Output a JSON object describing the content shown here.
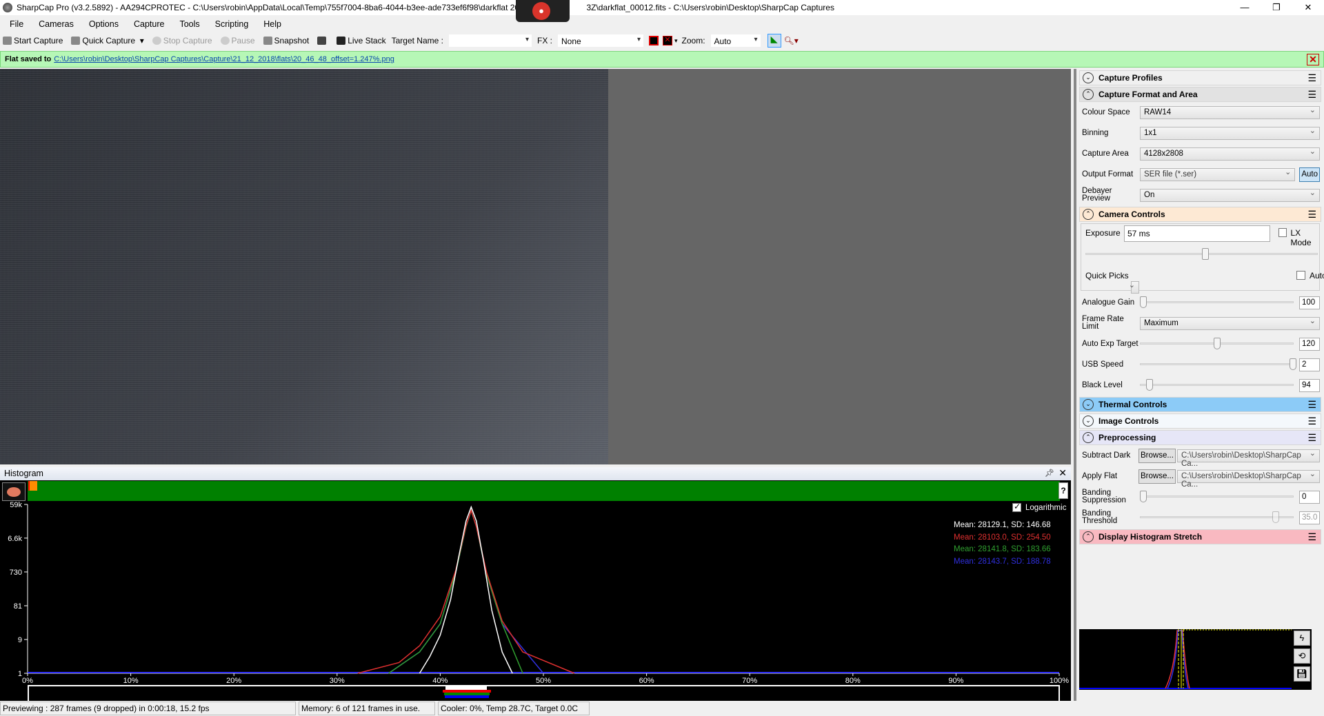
{
  "window": {
    "title": "SharpCap Pro (v3.2.5892) - AA294CPROTEC - C:\\Users\\robin\\AppData\\Local\\Temp\\755f7004-8ba6-4044-b3ee-ade733ef6f98\\darkflat 2018-",
    "title_tail": "3Z\\darkflat_00012.fits - C:\\Users\\robin\\Desktop\\SharpCap Captures",
    "minimize": "—",
    "restore": "❐",
    "close": "✕"
  },
  "menu": [
    "File",
    "Cameras",
    "Options",
    "Capture",
    "Tools",
    "Scripting",
    "Help"
  ],
  "toolbar": {
    "start_capture": "Start Capture",
    "quick_capture": "Quick Capture",
    "stop_capture": "Stop Capture",
    "pause": "Pause",
    "snapshot": "Snapshot",
    "live_stack": "Live Stack",
    "target_name_label": "Target Name :",
    "target_name_value": "",
    "fx_label": "FX :",
    "fx_value": "None",
    "zoom_label": "Zoom:",
    "zoom_value": "Auto"
  },
  "notice": {
    "prefix": "Flat saved to",
    "link": "C:\\Users\\robin\\Desktop\\SharpCap Captures\\Capture\\21_12_2018\\flats\\20_46_48_offset=1.247%.png",
    "close": "✕"
  },
  "histogram": {
    "title": "Histogram",
    "help": "?",
    "log_label": "Logarithmic",
    "log_checked": true,
    "stats": [
      {
        "text": "Mean: 28129.1, SD: 146.68",
        "color": "#ffffff"
      },
      {
        "text": "Mean: 28103.0, SD: 254.50",
        "color": "#e03030"
      },
      {
        "text": "Mean: 28141.8, SD: 183.66",
        "color": "#30a030"
      },
      {
        "text": "Mean: 28143.7, SD: 188.78",
        "color": "#3030e0"
      }
    ]
  },
  "chart_data": {
    "type": "line",
    "yscale": "log",
    "ylim": [
      1,
      59000
    ],
    "xlim": [
      0,
      100
    ],
    "y_ticks": [
      "59k",
      "6.6k",
      "730",
      "81",
      "9",
      "1"
    ],
    "y_tick_values": [
      59000,
      6600,
      730,
      81,
      9,
      1
    ],
    "x_ticks": [
      "0%",
      "10%",
      "20%",
      "30%",
      "40%",
      "50%",
      "60%",
      "70%",
      "80%",
      "90%",
      "100%"
    ],
    "series": [
      {
        "color": "#ffffff",
        "x": [
          38,
          39,
          40,
          41,
          41.8,
          42.5,
          43,
          43.5,
          44.2,
          45,
          46,
          47
        ],
        "y": [
          1,
          3,
          12,
          120,
          2000,
          20000,
          50000,
          20000,
          1500,
          60,
          4,
          1
        ]
      },
      {
        "color": "#e03030",
        "x": [
          32,
          36,
          38,
          40,
          41.5,
          42.5,
          43,
          43.5,
          44.5,
          46,
          48,
          53
        ],
        "y": [
          1,
          2,
          6,
          40,
          800,
          15000,
          40000,
          14000,
          700,
          30,
          4,
          1
        ]
      },
      {
        "color": "#30a030",
        "x": [
          35,
          38,
          40,
          41.5,
          42.5,
          43,
          43.5,
          44.5,
          46,
          48
        ],
        "y": [
          1,
          4,
          25,
          700,
          14000,
          40000,
          14000,
          600,
          25,
          1
        ]
      },
      {
        "color": "#3030e0",
        "x": [
          35,
          38,
          40,
          41.5,
          42.5,
          43,
          43.5,
          44.5,
          46,
          50
        ],
        "y": [
          1,
          4,
          25,
          700,
          14000,
          40000,
          14000,
          600,
          25,
          1
        ]
      }
    ]
  },
  "status": {
    "preview": "Previewing : 287 frames (9 dropped) in 0:00:18, 15.2 fps",
    "memory": "Memory: 6 of 121 frames in use.",
    "cooler": "Cooler: 0%, Temp 28.7C, Target 0.0C"
  },
  "panel": {
    "capture_profiles": "Capture Profiles",
    "capture_format": {
      "title": "Capture Format and Area",
      "colour_space_label": "Colour Space",
      "colour_space": "RAW14",
      "binning_label": "Binning",
      "binning": "1x1",
      "capture_area_label": "Capture Area",
      "capture_area": "4128x2808",
      "output_format_label": "Output Format",
      "output_format": "SER file (*.ser)",
      "auto": "Auto",
      "debayer_label": "Debayer Preview",
      "debayer": "On"
    },
    "camera_controls": {
      "title": "Camera Controls",
      "exposure_label": "Exposure",
      "exposure": "57 ms",
      "lx_mode": "LX Mode",
      "quick_picks_label": "Quick Picks",
      "quick_picks": "",
      "auto": "Auto",
      "gain_label": "Analogue Gain",
      "gain": "100",
      "frame_rate_label": "Frame Rate Limit",
      "frame_rate": "Maximum",
      "auto_exp_label": "Auto Exp Target",
      "auto_exp": "120",
      "usb_label": "USB Speed",
      "usb": "2",
      "black_label": "Black Level",
      "black": "94"
    },
    "thermal": "Thermal Controls",
    "image_controls": "Image Controls",
    "preprocessing": {
      "title": "Preprocessing",
      "dark_label": "Subtract Dark",
      "flat_label": "Apply Flat",
      "browse": "Browse...",
      "dark_path": "C:\\Users\\robin\\Desktop\\SharpCap Ca...",
      "flat_path": "C:\\Users\\robin\\Desktop\\SharpCap Ca...",
      "banding_supp_label": "Banding Suppression",
      "banding_supp": "0",
      "banding_thresh_label": "Banding Threshold",
      "banding_thresh": "35.0"
    },
    "stretch": "Display Histogram Stretch",
    "colors": {
      "thermal": "#8ccbf7",
      "camera": "#fde9d4",
      "stretch": "#f9b9c1",
      "preprocessing": "#e6e6f7"
    }
  }
}
